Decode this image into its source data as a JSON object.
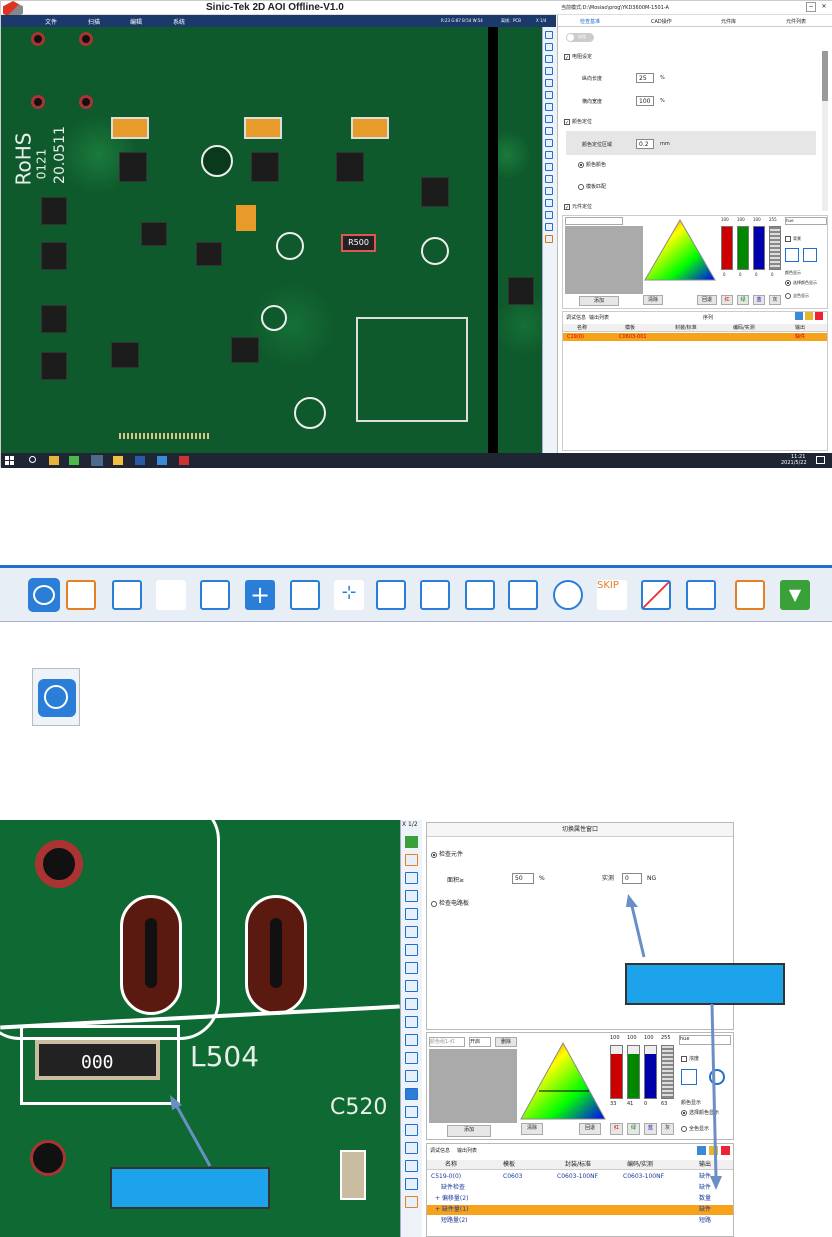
{
  "app": {
    "title": "Sinic-Tek 2D AOI Offline-V1.0",
    "menu": [
      "文件",
      "扫描",
      "编辑",
      "系统"
    ],
    "status_info": "R:23 G:87 B:54 W:54",
    "mode": "离线：PCB",
    "zoom": "X 1/4",
    "path": "当前模式:D:\\Mosiao\\prog\\YKD3600M-1501-A"
  },
  "tabs": [
    "检查基准",
    "CAD操作",
    "元件库",
    "元件列表"
  ],
  "params": {
    "toggle": "启用",
    "check1": "电阻设定",
    "len_label": "纵向长度",
    "len_val": "25",
    "len_unit": "%",
    "wid_label": "横向宽度",
    "wid_val": "100",
    "wid_unit": "%",
    "check2": "颜色定位",
    "area_label": "颜色定位区域",
    "area_val": "0.2",
    "area_unit": "mm",
    "radio1": "颜色颜色",
    "radio2": "模板匹配",
    "check3": "元件定位"
  },
  "color": {
    "rgb_vals": [
      "100",
      "100",
      "100",
      "255"
    ],
    "low_vals": [
      "0",
      "0",
      "0",
      "0"
    ],
    "mode": "hue",
    "btn_add": "添加",
    "btn_clear": "清除",
    "btn_back": "回退",
    "colors": [
      "红",
      "绿",
      "蓝",
      "灰"
    ],
    "opt_bg": "背景",
    "opt_color_show": "颜色显示",
    "opt_sel": "选择颜色显示",
    "opt_all": "全色显示"
  },
  "results": {
    "tabs": [
      "调试信息",
      "输出列表"
    ],
    "title": "序列",
    "headers": [
      "名称",
      "模板",
      "封装/标准",
      "编码/实测",
      "输出"
    ],
    "row": [
      "C19(0)",
      "C0603-001",
      "",
      "",
      "缺件"
    ]
  },
  "taskbar": {
    "time": "11:21",
    "date": "2021/5/22"
  },
  "bottom_params": {
    "title": "切换属性窗口",
    "r1": "检查元件",
    "area_label": "面积≥",
    "area_val": "50",
    "area_unit": "%",
    "actual_label": "实测",
    "actual_val": "0",
    "actual_unit": "NG",
    "r2": "检查电路板"
  },
  "bottom_color": {
    "group": "颜色组1-红",
    "open": "开启",
    "del": "删除",
    "hi": [
      "100",
      "100",
      "100",
      "255"
    ],
    "lo": [
      "33",
      "41",
      "0",
      "63"
    ],
    "mode": "hue",
    "add": "添加",
    "clear": "清除",
    "back": "回退",
    "colors": [
      "红",
      "绿",
      "蓝",
      "灰"
    ],
    "opt_bg": "浓度",
    "opt_color": "颜色显示",
    "opt_sel": "选择颜色显示",
    "opt_all": "全色显示"
  },
  "bottom_results": {
    "tabs": [
      "调试信息",
      "输出列表"
    ],
    "headers": [
      "名称",
      "模板",
      "封装/标准",
      "编码/实测",
      "输出"
    ],
    "rows": [
      [
        "C519-0(0)",
        "C0603",
        "C0603-100NF",
        "C0603-100NF",
        "缺件"
      ],
      [
        "缺件检查",
        "",
        "",
        "",
        "缺件"
      ],
      [
        "+ 偏移量(2)",
        "",
        "",
        "",
        "数量"
      ],
      [
        "+ 缺件量(1)",
        "",
        "",
        "",
        "缺件"
      ],
      [
        "短路量(2)",
        "",
        "",
        "",
        "短路"
      ]
    ]
  },
  "zoom2": "X 1/2",
  "pcb_text": {
    "rohs": "RoHS",
    "date": "20.0511",
    "lot": "0121",
    "r500": "R500",
    "l504": "L504",
    "c520": "C520",
    "zero": "000"
  },
  "accent": "#1e6fd0",
  "highlight": "#f7a21b",
  "callout": "#1ca3ec"
}
